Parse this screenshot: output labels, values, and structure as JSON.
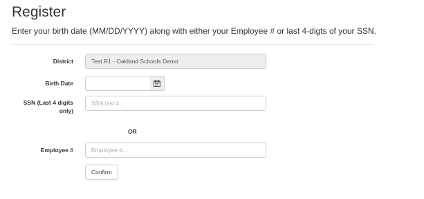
{
  "page": {
    "title": "Register",
    "subtitle": "Enter your birth date (MM/DD/YYYY) along with either your Employee # or last 4-digts of your SSN."
  },
  "form": {
    "district": {
      "label": "District",
      "value": "Test R1 - Oakland Schools Demo"
    },
    "birth_date": {
      "label": "Birth Date",
      "value": "",
      "placeholder": "",
      "icon": "calendar-icon"
    },
    "ssn": {
      "label_line1": "SSN (Last 4 digits",
      "label_line2": "only)",
      "value": "",
      "placeholder": "SSN last 4.."
    },
    "or_text": "OR",
    "employee": {
      "label": "Employee #",
      "value": "",
      "placeholder": "Employee #..."
    },
    "confirm_label": "Confirm"
  }
}
